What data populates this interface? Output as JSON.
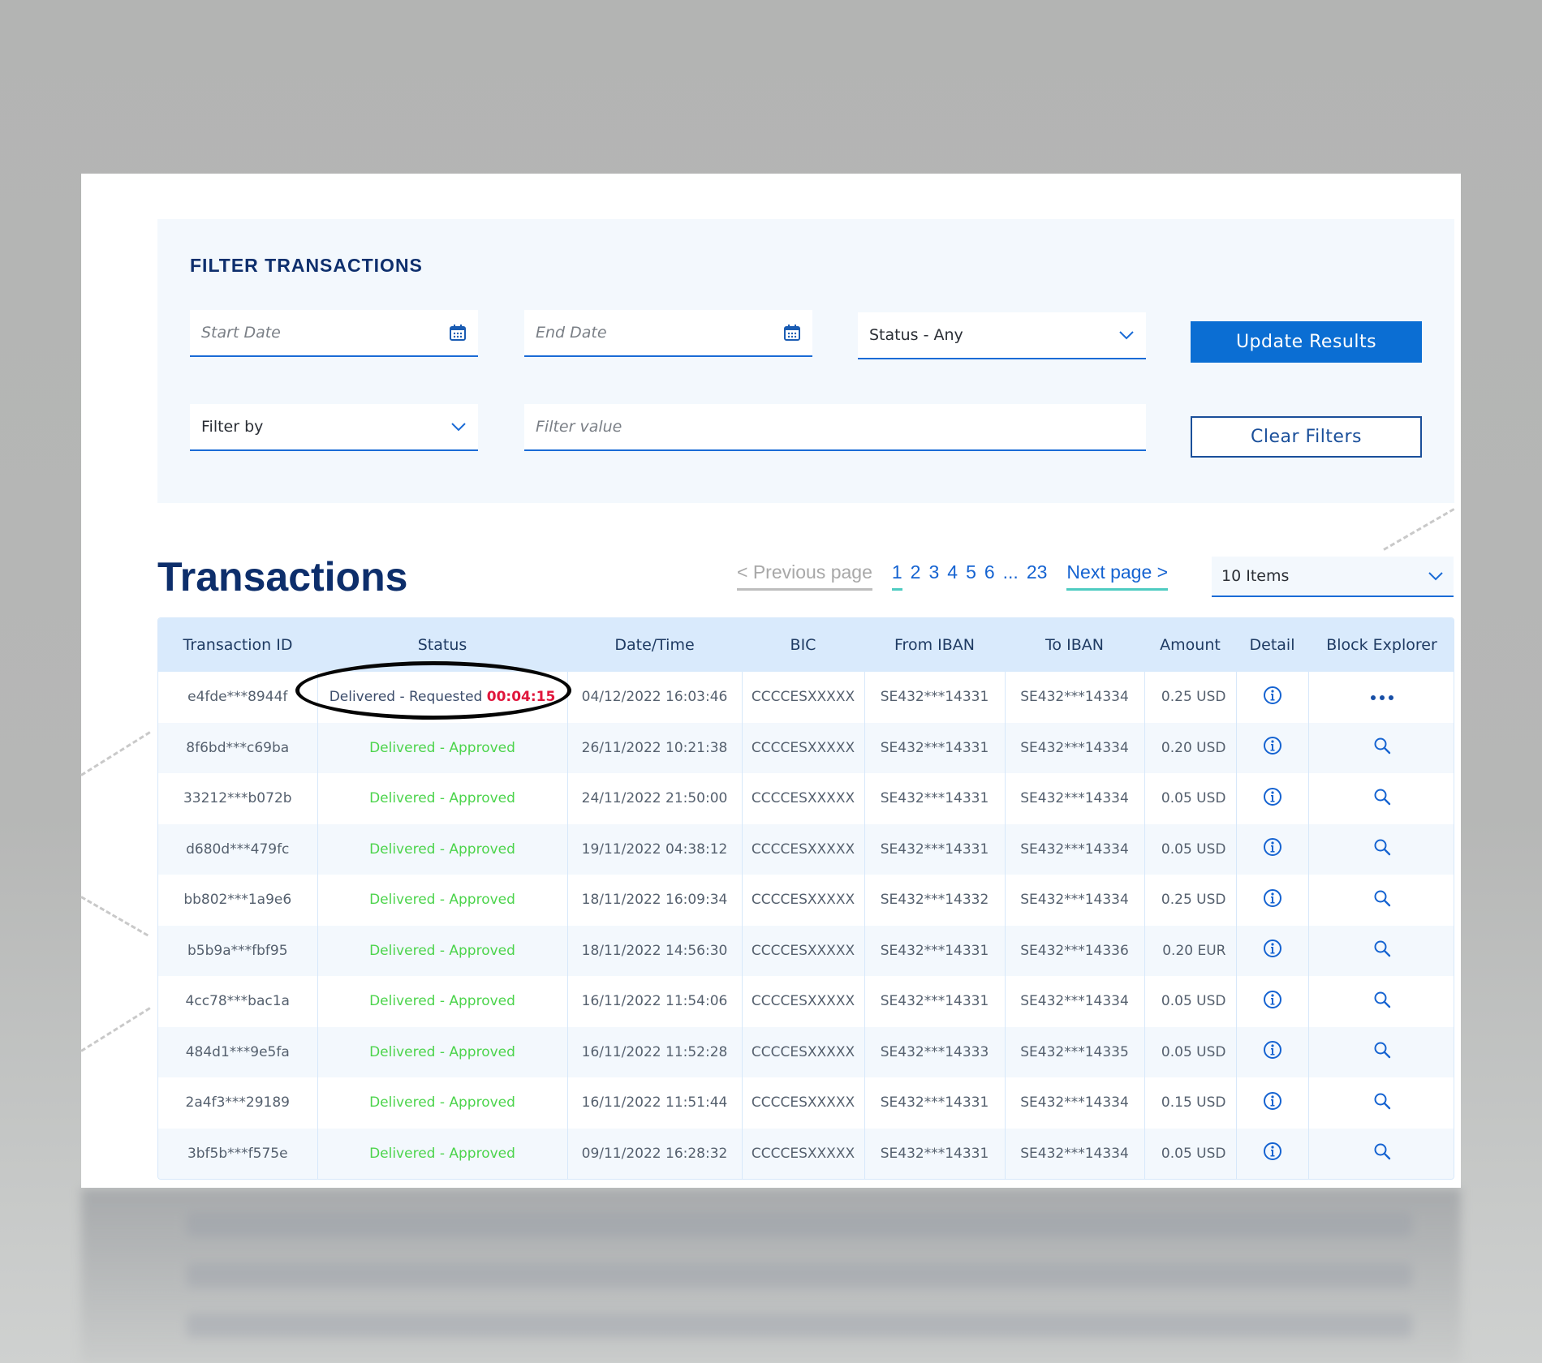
{
  "filter": {
    "title": "FILTER TRANSACTIONS",
    "start_date_placeholder": "Start Date",
    "end_date_placeholder": "End Date",
    "status_select": "Status - Any",
    "filter_by_select": "Filter by",
    "filter_value_placeholder": "Filter value",
    "update_button": "Update Results",
    "clear_button": "Clear Filters"
  },
  "transactions": {
    "title": "Transactions",
    "pagination": {
      "prev_label": "< Previous page",
      "pages": [
        "1",
        "2",
        "3",
        "4",
        "5",
        "6"
      ],
      "active_page": "1",
      "ellipsis": "...",
      "last_page": "23",
      "next_label": "Next page >"
    },
    "items_per_page": "10 Items"
  },
  "table": {
    "columns": [
      "Transaction ID",
      "Status",
      "Date/Time",
      "BIC",
      "From IBAN",
      "To IBAN",
      "Amount",
      "Detail",
      "Block Explorer"
    ],
    "rows": [
      {
        "id": "e4fde***8944f",
        "status": "Delivered - Requested",
        "timer": "00:04:15",
        "datetime": "04/12/2022 16:03:46",
        "bic": "CCCCESXXXXX",
        "from": "SE432***14331",
        "to": "SE432***14334",
        "amount": "0.25 USD",
        "explorer": "more"
      },
      {
        "id": "8f6bd***c69ba",
        "status": "Delivered - Approved",
        "datetime": "26/11/2022 10:21:38",
        "bic": "CCCCESXXXXX",
        "from": "SE432***14331",
        "to": "SE432***14334",
        "amount": "0.20 USD",
        "explorer": "search"
      },
      {
        "id": "33212***b072b",
        "status": "Delivered - Approved",
        "datetime": "24/11/2022 21:50:00",
        "bic": "CCCCESXXXXX",
        "from": "SE432***14331",
        "to": "SE432***14334",
        "amount": "0.05 USD",
        "explorer": "search"
      },
      {
        "id": "d680d***479fc",
        "status": "Delivered - Approved",
        "datetime": "19/11/2022 04:38:12",
        "bic": "CCCCESXXXXX",
        "from": "SE432***14331",
        "to": "SE432***14334",
        "amount": "0.05 USD",
        "explorer": "search"
      },
      {
        "id": "bb802***1a9e6",
        "status": "Delivered - Approved",
        "datetime": "18/11/2022 16:09:34",
        "bic": "CCCCESXXXXX",
        "from": "SE432***14332",
        "to": "SE432***14334",
        "amount": "0.25 USD",
        "explorer": "search"
      },
      {
        "id": "b5b9a***fbf95",
        "status": "Delivered - Approved",
        "datetime": "18/11/2022 14:56:30",
        "bic": "CCCCESXXXXX",
        "from": "SE432***14331",
        "to": "SE432***14336",
        "amount": "0.20 EUR",
        "explorer": "search"
      },
      {
        "id": "4cc78***bac1a",
        "status": "Delivered - Approved",
        "datetime": "16/11/2022 11:54:06",
        "bic": "CCCCESXXXXX",
        "from": "SE432***14331",
        "to": "SE432***14334",
        "amount": "0.05 USD",
        "explorer": "search"
      },
      {
        "id": "484d1***9e5fa",
        "status": "Delivered - Approved",
        "datetime": "16/11/2022 11:52:28",
        "bic": "CCCCESXXXXX",
        "from": "SE432***14333",
        "to": "SE432***14335",
        "amount": "0.05 USD",
        "explorer": "search"
      },
      {
        "id": "2a4f3***29189",
        "status": "Delivered - Approved",
        "datetime": "16/11/2022 11:51:44",
        "bic": "CCCCESXXXXX",
        "from": "SE432***14331",
        "to": "SE432***14334",
        "amount": "0.15 USD",
        "explorer": "search"
      },
      {
        "id": "3bf5b***f575e",
        "status": "Delivered - Approved",
        "datetime": "09/11/2022 16:28:32",
        "bic": "CCCCESXXXXX",
        "from": "SE432***14331",
        "to": "SE432***14334",
        "amount": "0.05 USD",
        "explorer": "search"
      }
    ]
  },
  "icons": {
    "calendar": "calendar-icon",
    "chevron": "chevron-down-icon",
    "detail": "info-icon",
    "explorer_search": "search-icon",
    "explorer_more": "more-horizontal-icon"
  },
  "colors": {
    "primary": "#0b6ed3",
    "title": "#0d2e6b",
    "approved": "#4cd44c",
    "timer": "#e0163c",
    "header_bg": "#d9eafc",
    "panel_bg": "#f3f8fd",
    "accent_underline": "#4ecbc1"
  }
}
